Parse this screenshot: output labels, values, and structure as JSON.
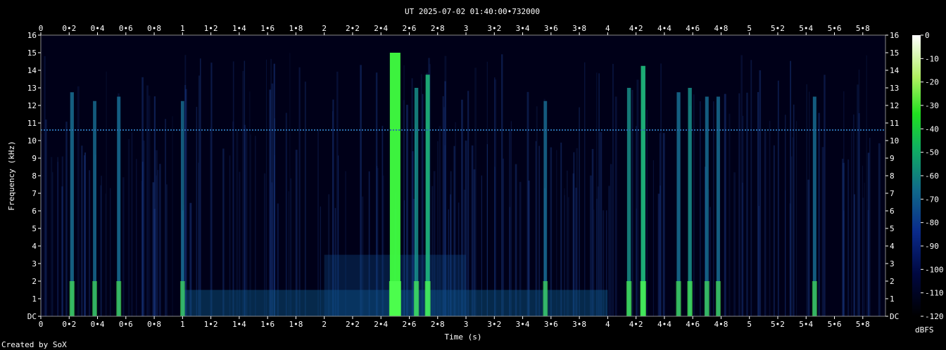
{
  "chart_data": {
    "type": "heatmap",
    "title": "UT 2025-07-02 01:40:00•732000",
    "xlabel": "Time (s)",
    "ylabel": "Frequency (kHz)",
    "xlim": [
      0,
      5.96
    ],
    "ylim": [
      0,
      16
    ],
    "x_ticks": [
      "0",
      "0•2",
      "0•4",
      "0•6",
      "0•8",
      "1",
      "1•2",
      "1•4",
      "1•6",
      "1•8",
      "2",
      "2•2",
      "2•4",
      "2•6",
      "2•8",
      "3",
      "3•2",
      "3•4",
      "3•6",
      "3•8",
      "4",
      "4•2",
      "4•4",
      "4•6",
      "4•8",
      "5",
      "5•2",
      "5•4",
      "5•6",
      "5•8"
    ],
    "y_ticks": [
      "DC",
      "1",
      "2",
      "3",
      "4",
      "5",
      "6",
      "7",
      "8",
      "9",
      "10",
      "11",
      "12",
      "13",
      "14",
      "15",
      "16"
    ],
    "colorbar": {
      "label": "dBFS",
      "range": [
        -120,
        0
      ],
      "ticks": [
        "0",
        "-10",
        "-20",
        "-30",
        "-40",
        "-50",
        "-60",
        "-70",
        "-80",
        "-90",
        "-100",
        "-110",
        "-120"
      ]
    },
    "horizontal_tone_khz": 10.6,
    "strong_events": [
      {
        "t": 0.22,
        "intensity": 0.55
      },
      {
        "t": 0.38,
        "intensity": 0.45
      },
      {
        "t": 0.55,
        "intensity": 0.5
      },
      {
        "t": 1.0,
        "intensity": 0.45
      },
      {
        "t": 2.5,
        "intensity": 1.0
      },
      {
        "t": 2.65,
        "intensity": 0.6
      },
      {
        "t": 2.73,
        "intensity": 0.75
      },
      {
        "t": 3.56,
        "intensity": 0.45
      },
      {
        "t": 4.15,
        "intensity": 0.6
      },
      {
        "t": 4.25,
        "intensity": 0.85
      },
      {
        "t": 4.5,
        "intensity": 0.55
      },
      {
        "t": 4.58,
        "intensity": 0.6
      },
      {
        "t": 4.7,
        "intensity": 0.5
      },
      {
        "t": 4.78,
        "intensity": 0.5
      },
      {
        "t": 5.46,
        "intensity": 0.5
      }
    ]
  },
  "footer": {
    "credit": "Created by SoX"
  }
}
